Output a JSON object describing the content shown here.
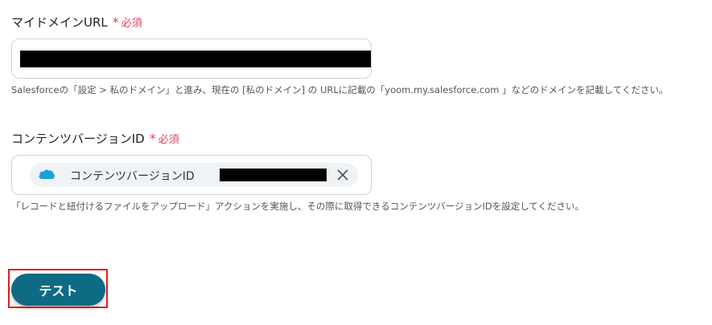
{
  "domain_field": {
    "label": "マイドメインURL",
    "required_mark": "*",
    "required_text": "必須",
    "helper": "Salesforceの「設定 > 私のドメイン」と進み、現在の [私のドメイン] の URLに記載の「yoom.my.salesforce.com 」などのドメインを記載してください。"
  },
  "content_version_field": {
    "label": "コンテンツバージョンID",
    "required_mark": "*",
    "required_text": "必須",
    "chip_label": "コンテンツバージョンID",
    "chip_icon": "salesforce-cloud-icon",
    "helper": "「レコードと紐付けるファイルをアップロード」アクションを実施し、その際に取得できるコンテンツバージョンIDを設定してください。"
  },
  "actions": {
    "test_label": "テスト"
  },
  "colors": {
    "required": "#e0475a",
    "button_bg": "#0e6b84",
    "highlight_outline": "#e02020",
    "salesforce_blue": "#1ea0dc"
  }
}
